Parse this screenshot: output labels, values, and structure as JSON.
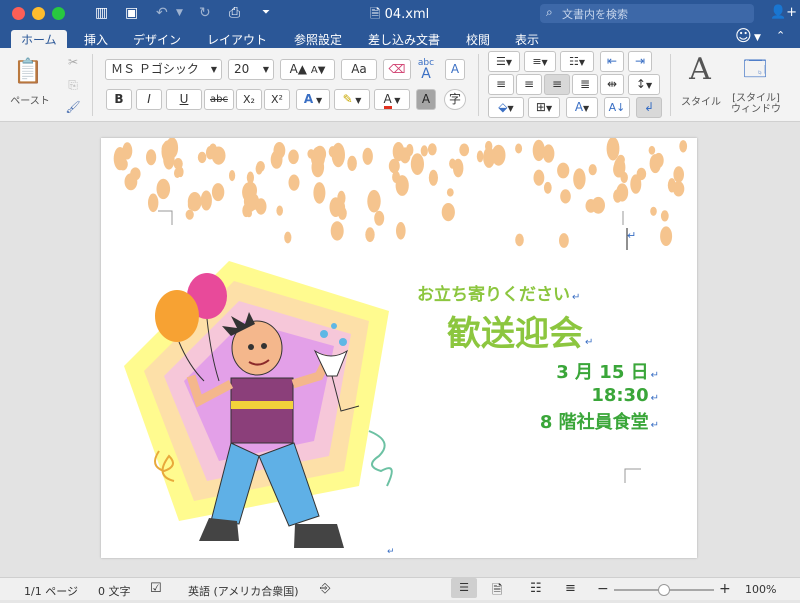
{
  "window": {
    "title": "04.xml"
  },
  "search": {
    "placeholder": "文書内を検索"
  },
  "tabs": [
    "ホーム",
    "挿入",
    "デザイン",
    "レイアウト",
    "参照設定",
    "差し込み文書",
    "校閲",
    "表示"
  ],
  "ribbon": {
    "paste_label": "ペースト",
    "font_name": "ＭＳ Ｐゴシック",
    "font_size": "20",
    "bold": "B",
    "italic": "I",
    "underline": "U",
    "strike": "abc",
    "sub": "X₂",
    "sup": "X²",
    "grow": "A▲",
    "shrink": "A▼",
    "case": "Aa",
    "clear_sample": "abc",
    "clear_a": "A",
    "frame_a": "A",
    "shade_a": "A",
    "enclose": "字",
    "styles_label": "スタイル",
    "styles_pane_label": "[スタイル] ウィンドウ"
  },
  "document": {
    "line1": "お立ち寄りください",
    "line2": "歓送迎会",
    "line3": "3 月 15 日",
    "line4": "18:30",
    "line5": "8 階社員食堂",
    "return_mark": "↵"
  },
  "status": {
    "page": "1/1 ページ",
    "words": "0 文字",
    "language": "英語 (アメリカ合衆国)",
    "zoom_minus": "−",
    "zoom_plus": "+",
    "zoom": "100%",
    "zoom_level": 0.5
  },
  "colors": {
    "accent": "#2b5797",
    "title_green": "#8cc63f",
    "date_green": "#3aa639",
    "dots": "#f5c48e"
  }
}
